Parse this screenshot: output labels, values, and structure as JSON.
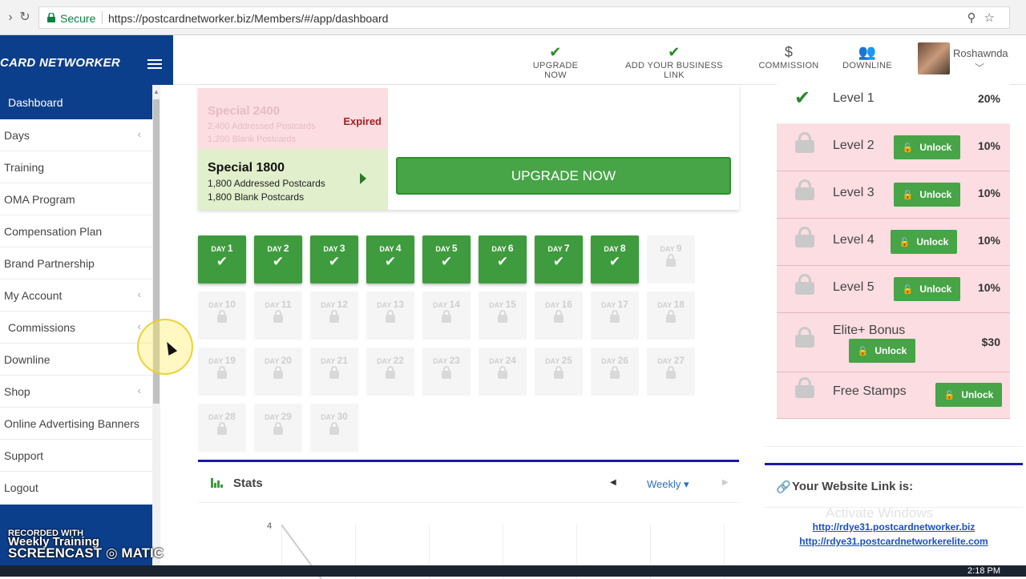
{
  "browser": {
    "secure_label": "Secure",
    "url": "https://postcardnetworker.biz/Members/#/app/dashboard"
  },
  "header": {
    "brand": "CARD NETWORKER",
    "nav": [
      {
        "label": "UPGRADE NOW",
        "icon": "check-icon"
      },
      {
        "label": "ADD YOUR BUSINESS LINK",
        "icon": "check-icon"
      },
      {
        "label": "COMMISSION",
        "icon": "dollar-icon"
      },
      {
        "label": "DOWNLINE",
        "icon": "users-icon"
      }
    ],
    "user_name": "Roshawnda"
  },
  "sidebar": {
    "active": "Dashboard",
    "items": [
      {
        "label": "Days"
      },
      {
        "label": "Training"
      },
      {
        "label": "OMA Program"
      },
      {
        "label": "Compensation Plan"
      },
      {
        "label": "Brand Partnership"
      },
      {
        "label": "My Account"
      },
      {
        "label": "Commissions"
      },
      {
        "label": "Downline"
      },
      {
        "label": "Shop"
      },
      {
        "label": "Online Advertising Banners"
      },
      {
        "label": "Support"
      },
      {
        "label": "Logout"
      }
    ]
  },
  "specials": {
    "expired": {
      "title": "Special 2400",
      "line1": "2,400 Addressed Postcards",
      "line2": "1,200 Blank Postcards",
      "status": "Expired"
    },
    "active": {
      "title": "Special 1800",
      "line1": "1,800 Addressed Postcards",
      "line2": "1,800 Blank Postcards"
    },
    "upgrade_label": "UPGRADE NOW"
  },
  "days": {
    "prefix": "DAY",
    "completed": 8,
    "total": 30
  },
  "stats": {
    "title": "Stats",
    "period": "Weekly",
    "y_top": "4"
  },
  "levels": [
    {
      "name": "Level 1",
      "value": "20%",
      "unlocked": true
    },
    {
      "name": "Level 2",
      "value": "10%",
      "unlocked": false,
      "button": "Unlock"
    },
    {
      "name": "Level 3",
      "value": "10%",
      "unlocked": false,
      "button": "Unlock"
    },
    {
      "name": "Level 4",
      "value": "10%",
      "unlocked": false,
      "button": "Unlock"
    },
    {
      "name": "Level 5",
      "value": "10%",
      "unlocked": false,
      "button": "Unlock"
    },
    {
      "name": "Elite+ Bonus",
      "value": "$30",
      "unlocked": false,
      "button": "Unlock"
    },
    {
      "name": "Free Stamps",
      "value": "",
      "unlocked": false,
      "button": "Unlock"
    }
  ],
  "website_link": {
    "title": "Your Website Link is:",
    "links": [
      "http://rdye31.postcardnetworker.biz",
      "http://rdye31.postcardnetworkerelite.com"
    ],
    "watermark": "Activate Windows"
  },
  "overlay": {
    "recorded_with": "RECORDED WITH",
    "weekly_training": "Weekly Training",
    "screencast": "SCREENCAST",
    "matic": "MATIC"
  },
  "taskbar": {
    "clock": "2:18 PM"
  },
  "colors": {
    "brand_blue": "#0c3f8b",
    "success_green": "#47a447",
    "locked_pink": "#fbdde2"
  }
}
